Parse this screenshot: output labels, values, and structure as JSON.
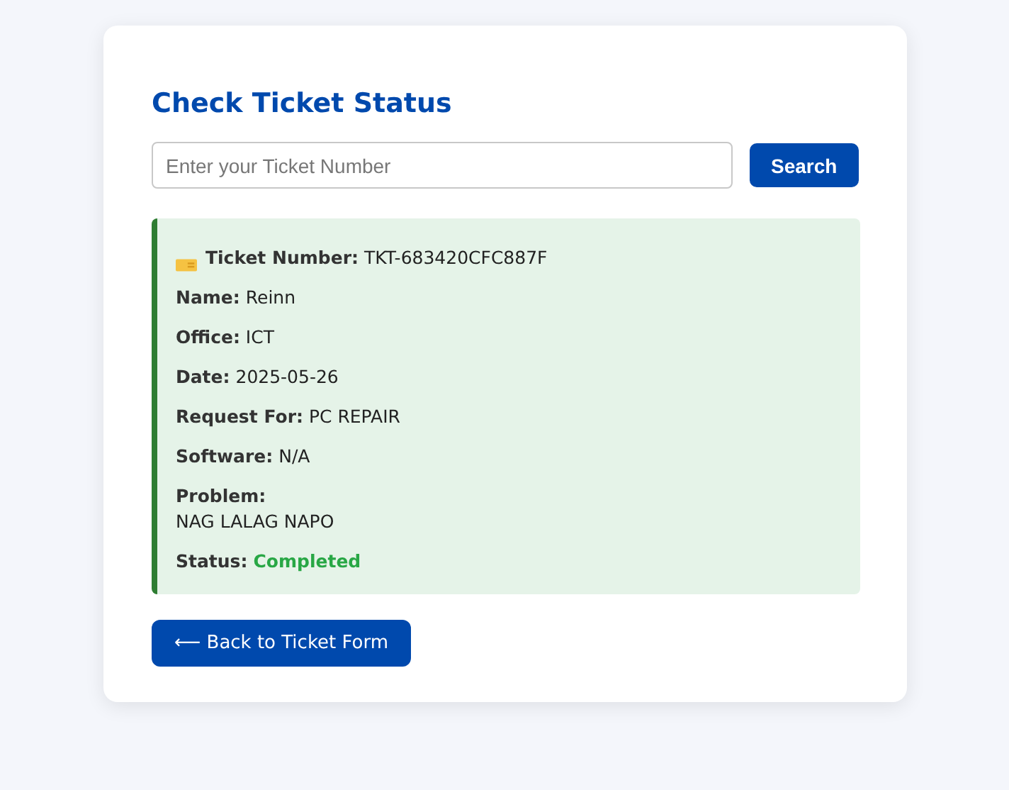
{
  "title": "Check Ticket Status",
  "search": {
    "placeholder": "Enter your Ticket Number",
    "button": "Search"
  },
  "result": {
    "fields": [
      {
        "label": "Ticket Number:",
        "value": "TKT-683420CFC887F",
        "kind": "ticket"
      },
      {
        "label": "Name:",
        "value": "Reinn",
        "kind": "inline"
      },
      {
        "label": "Office:",
        "value": "ICT",
        "kind": "inline"
      },
      {
        "label": "Date:",
        "value": "2025-05-26",
        "kind": "inline"
      },
      {
        "label": "Request For:",
        "value": "PC REPAIR",
        "kind": "inline"
      },
      {
        "label": "Software:",
        "value": "N/A",
        "kind": "inline"
      },
      {
        "label": "Problem:",
        "value": "NAG LALAG NAPO",
        "kind": "block"
      },
      {
        "label": "Status:",
        "value": "Completed",
        "kind": "status",
        "color": "#28a745"
      }
    ]
  },
  "back_button": "⟵ Back to Ticket Form"
}
